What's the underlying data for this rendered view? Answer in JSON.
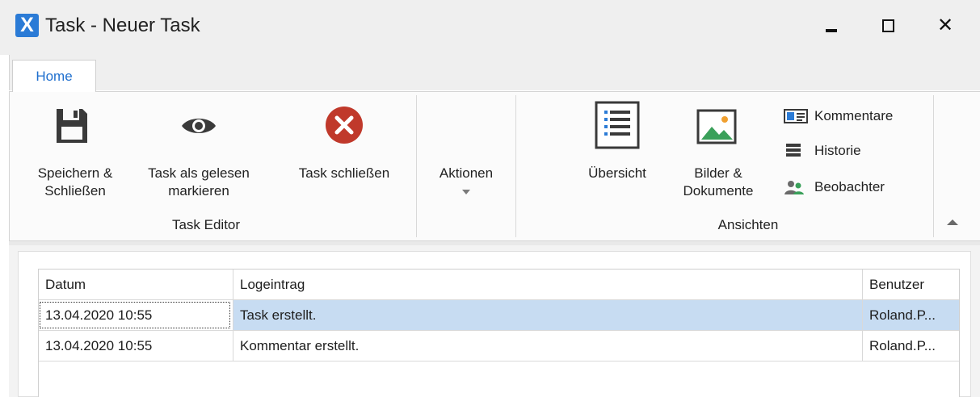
{
  "window": {
    "logo_letter": "X",
    "title": "Task - Neuer Task",
    "close_glyph": "✕"
  },
  "ribbon": {
    "tabs": [
      {
        "label": "Home",
        "active": true
      }
    ],
    "groups": {
      "task_editor": {
        "label": "Task Editor",
        "buttons": {
          "save_close": {
            "label_line1": "Speichern &",
            "label_line2": "Schließen",
            "icon": "floppy-disk-icon"
          },
          "mark_read": {
            "label_line1": "Task als gelesen",
            "label_line2": "markieren",
            "icon": "eye-icon"
          },
          "close_task": {
            "label": "Task schließen",
            "icon": "close-circle-icon",
            "color": "#c0392b"
          }
        }
      },
      "aktionen": {
        "label": "Aktionen",
        "dropdown_icon": "caret-down-icon"
      },
      "ansichten": {
        "label": "Ansichten",
        "buttons": {
          "uebersicht": {
            "label": "Übersicht",
            "icon": "list-document-icon"
          },
          "bilder": {
            "label_line1": "Bilder &",
            "label_line2": "Dokumente",
            "icon": "picture-icon"
          },
          "kommentare": {
            "label": "Kommentare",
            "icon": "id-card-icon"
          },
          "historie": {
            "label": "Historie",
            "icon": "stack-icon"
          },
          "beobachter": {
            "label": "Beobachter",
            "icon": "users-icon"
          }
        }
      }
    }
  },
  "grid": {
    "columns": [
      "Datum",
      "Logeintrag",
      "Benutzer"
    ],
    "rows": [
      {
        "datum": "13.04.2020 10:55",
        "logeintrag": "Task erstellt.",
        "benutzer": "Roland.P...",
        "selected": true
      },
      {
        "datum": "13.04.2020 10:55",
        "logeintrag": "Kommentar erstellt.",
        "benutzer": "Roland.P..."
      }
    ],
    "selection_color": "#c7dcf2"
  },
  "colors": {
    "accent": "#1f6fce",
    "logo": "#2b7bd6"
  }
}
